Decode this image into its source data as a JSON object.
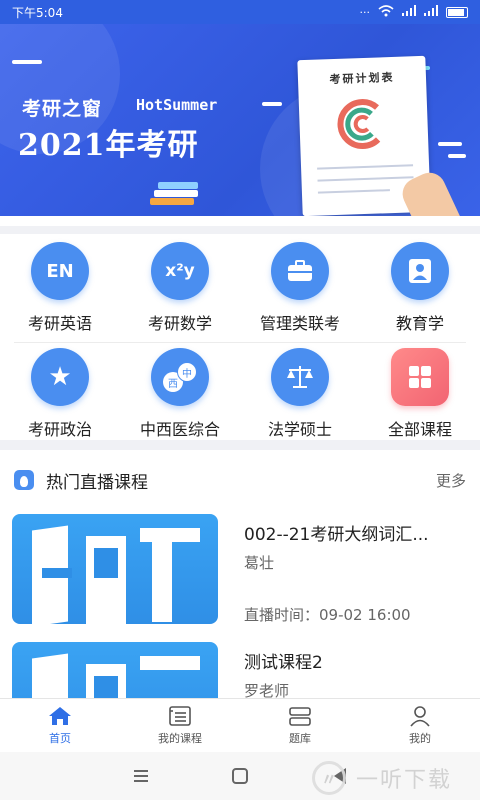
{
  "status_bar": {
    "time": "下午5:04"
  },
  "banner": {
    "subtitle": "考研之窗",
    "brand": "HotSummer",
    "title": "2021年考研",
    "paper_title": "考研计划表"
  },
  "categories": [
    {
      "label": "考研英语",
      "icon": "en-icon",
      "glyph": "EN"
    },
    {
      "label": "考研数学",
      "icon": "math-icon",
      "glyph": "x²y"
    },
    {
      "label": "管理类联考",
      "icon": "briefcase-icon",
      "glyph": ""
    },
    {
      "label": "教育学",
      "icon": "teacher-icon",
      "glyph": ""
    },
    {
      "label": "考研政治",
      "icon": "star-icon",
      "glyph": "★"
    },
    {
      "label": "中西医综合",
      "icon": "chinese-western-icon",
      "glyph": "中西"
    },
    {
      "label": "法学硕士",
      "icon": "scales-icon",
      "glyph": "⚖"
    },
    {
      "label": "全部课程",
      "icon": "grid-icon",
      "glyph": ""
    }
  ],
  "section": {
    "title": "热门直播课程",
    "more": "更多"
  },
  "courses": [
    {
      "title": "002--21考研大纲词汇...",
      "teacher": "葛壮",
      "time": "直播时间：09-02 16:00"
    },
    {
      "title": "测试课程2",
      "teacher": "罗老师",
      "time": ""
    }
  ],
  "tabs": [
    {
      "label": "首页",
      "icon": "home-icon"
    },
    {
      "label": "我的课程",
      "icon": "course-list-icon"
    },
    {
      "label": "题库",
      "icon": "question-bank-icon"
    },
    {
      "label": "我的",
      "icon": "profile-icon"
    }
  ],
  "watermark": {
    "text": "一听下载"
  },
  "colors": {
    "brand_blue": "#2f5fe0",
    "icon_blue": "#4a8ef0",
    "active_tab": "#2f6fe6",
    "pink": "#f26472"
  }
}
